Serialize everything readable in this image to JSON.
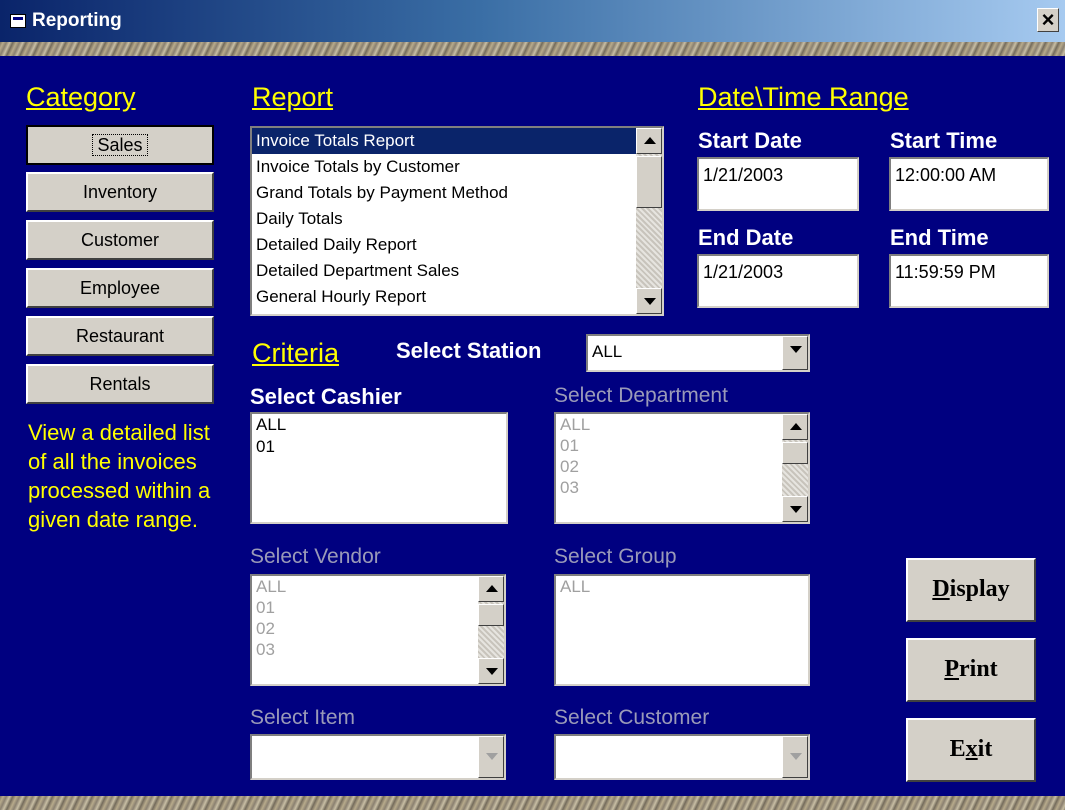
{
  "window": {
    "title": "Reporting",
    "close_label": "×"
  },
  "category": {
    "header": "Category",
    "buttons": [
      "Sales",
      "Inventory",
      "Customer",
      "Employee",
      "Restaurant",
      "Rentals"
    ],
    "description": "View a detailed list of all the invoices processed within a given date range."
  },
  "report": {
    "header": "Report",
    "items": [
      "Invoice Totals Report",
      "Invoice Totals by Customer",
      "Grand Totals by Payment Method",
      "Daily Totals",
      "Detailed Daily Report",
      "Detailed Department Sales",
      "General Hourly Report"
    ],
    "selected": "Invoice Totals Report"
  },
  "datetime": {
    "header": "Date\\Time Range",
    "start_date_label": "Start Date",
    "start_date": "1/21/2003",
    "start_time_label": "Start Time",
    "start_time": "12:00:00 AM",
    "end_date_label": "End Date",
    "end_date": "1/21/2003",
    "end_time_label": "End Time",
    "end_time": "11:59:59 PM"
  },
  "criteria": {
    "header": "Criteria",
    "station_label": "Select Station",
    "station_value": "ALL",
    "cashier_label": "Select Cashier",
    "cashier_items": [
      "ALL",
      "01"
    ],
    "department_label": "Select Department",
    "department_items": [
      "ALL",
      "01",
      "02",
      "03"
    ],
    "vendor_label": "Select Vendor",
    "vendor_items": [
      "ALL",
      "01",
      "02",
      "03"
    ],
    "group_label": "Select Group",
    "group_items": [
      "ALL"
    ],
    "item_label": "Select Item",
    "item_value": "",
    "customer_label": "Select Customer",
    "customer_value": ""
  },
  "actions": {
    "display_first": "D",
    "display_rest": "isplay",
    "print_first": "P",
    "print_rest": "rint",
    "exit_first": "E",
    "exit_mid": "x",
    "exit_rest": "it"
  },
  "colors": {
    "background": "#000080",
    "header": "#ffff00",
    "label": "#ffffff",
    "disabled_label": "#9a9ab8"
  },
  "icons": [
    "window-icon",
    "close-icon",
    "scroll-up-icon",
    "scroll-down-icon",
    "dropdown-arrow-icon"
  ]
}
